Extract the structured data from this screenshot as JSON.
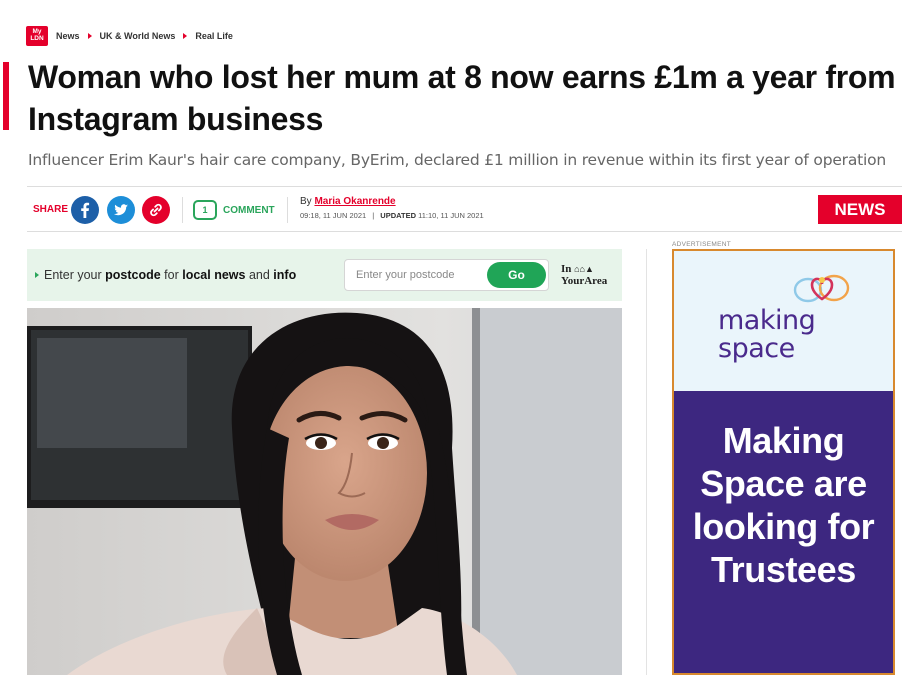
{
  "brand": {
    "logo_line1": "My",
    "logo_line2": "LDN",
    "accent": "#e4002b"
  },
  "breadcrumb": [
    "News",
    "UK & World News",
    "Real Life"
  ],
  "article": {
    "headline": "Woman who lost her mum at 8 now earns £1m a year from Instagram business",
    "standfirst": "Influencer Erim Kaur's hair care company, ByErim, declared £1 million in revenue within its first year of operation",
    "share_label": "SHARE",
    "share_icons": [
      "facebook-icon",
      "twitter-icon",
      "link-icon"
    ],
    "comment_count": "1",
    "comment_label": "COMMENT",
    "byline_prefix": "By",
    "author": "Maria Okanrende",
    "published": "09:18, 11 JUN 2021",
    "updated_label": "UPDATED",
    "updated": "11:10, 11 JUN 2021",
    "section_tag": "NEWS"
  },
  "postcode": {
    "text_1": "Enter your ",
    "text_bold_1": "postcode",
    "text_2": " for ",
    "text_bold_2": "local news",
    "text_3": " and ",
    "text_bold_3": "info",
    "placeholder": "Enter your postcode",
    "go_label": "Go",
    "partner_line1": "In",
    "partner_line2": "YourArea"
  },
  "advert": {
    "label": "ADVERTISEMENT",
    "brand_line1": "making",
    "brand_line2": "space",
    "message_lines": [
      "Making",
      "Space are",
      "looking for",
      "Trustees"
    ],
    "colors": {
      "purple": "#3d2780",
      "border": "#d8892e",
      "light": "#eaf5fb"
    }
  }
}
